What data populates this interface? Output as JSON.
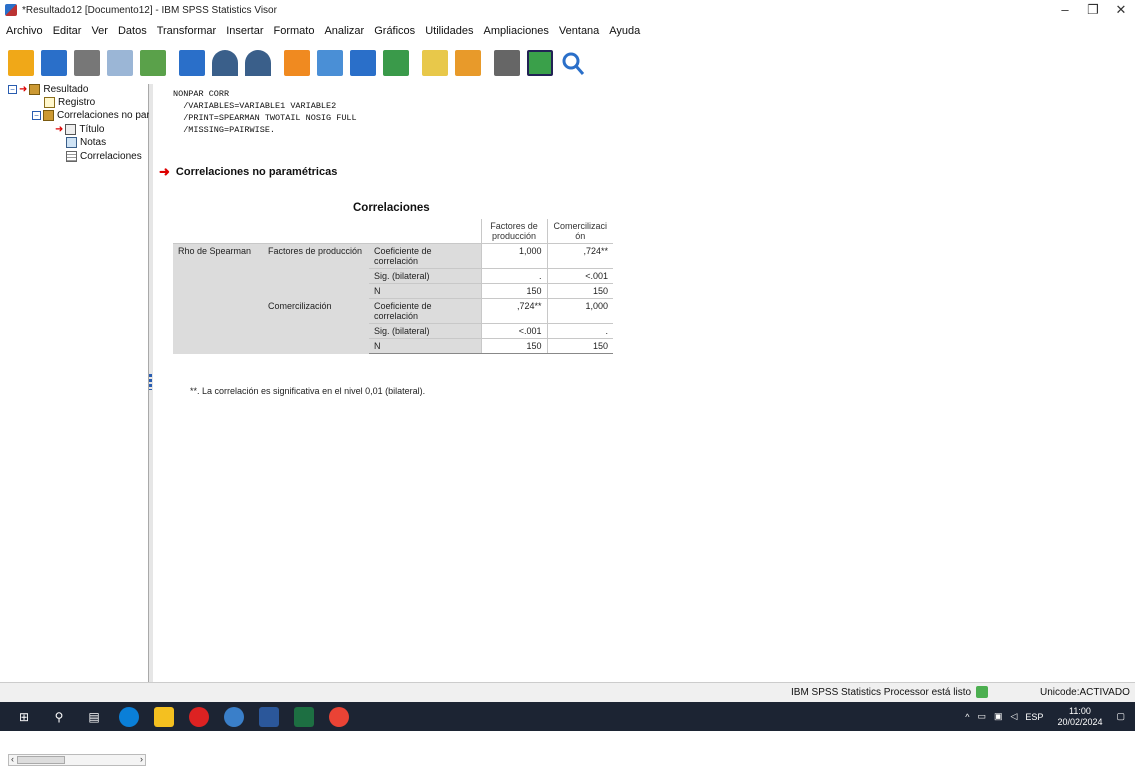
{
  "window": {
    "title": "*Resultado12 [Documento12] - IBM SPSS Statistics Visor"
  },
  "controls": {
    "minimize": "–",
    "maximize": "❐",
    "close": "✕"
  },
  "menu": [
    "Archivo",
    "Editar",
    "Ver",
    "Datos",
    "Transformar",
    "Insertar",
    "Formato",
    "Analizar",
    "Gráficos",
    "Utilidades",
    "Ampliaciones",
    "Ventana",
    "Ayuda"
  ],
  "toolbar": {
    "icons": [
      "open-icon",
      "save-icon",
      "print-icon",
      "print-preview-icon",
      "export-icon",
      "recall-dialog-icon",
      "undo-icon",
      "redo-icon",
      "goto-data-icon",
      "goto-case-icon",
      "goto-variable-icon",
      "variables-icon",
      "insert-output-icon",
      "create-title-icon",
      "hide-icon",
      "show-all-icon",
      "search-icon"
    ]
  },
  "tree": {
    "items": [
      {
        "label": "Resultado"
      },
      {
        "label": "Registro"
      },
      {
        "label": "Correlaciones no para"
      },
      {
        "label": "Título"
      },
      {
        "label": "Notas"
      },
      {
        "label": "Correlaciones"
      }
    ]
  },
  "content": {
    "syntax": "NONPAR CORR\n  /VARIABLES=VARIABLE1 VARIABLE2\n  /PRINT=SPEARMAN TWOTAIL NOSIG FULL\n  /MISSING=PAIRWISE.",
    "heading": "Correlaciones no paramétricas",
    "table": {
      "title": "Correlaciones",
      "col_headers": [
        "Factores de producción",
        "Comercilizaci ón"
      ],
      "row_group": "Rho de Spearman",
      "rows": [
        {
          "var": "Factores de producción",
          "stat": "Coeficiente de correlación",
          "v1": "1,000",
          "v2": ",724**"
        },
        {
          "var": "",
          "stat": "Sig. (bilateral)",
          "v1": ".",
          "v2": "<.001"
        },
        {
          "var": "",
          "stat": "N",
          "v1": "150",
          "v2": "150"
        },
        {
          "var": "Comercilización",
          "stat": "Coeficiente de correlación",
          "v1": ",724**",
          "v2": "1,000"
        },
        {
          "var": "",
          "stat": "Sig. (bilateral)",
          "v1": "<.001",
          "v2": "."
        },
        {
          "var": "",
          "stat": "N",
          "v1": "150",
          "v2": "150"
        }
      ],
      "footnote": "**. La correlación es significativa en el nivel 0,01 (bilateral)."
    }
  },
  "status": {
    "processor": "IBM SPSS Statistics Processor está listo",
    "unicode": "Unicode:ACTIVADO"
  },
  "taskbar": {
    "time": "11:00",
    "date": "20/02/2024",
    "lang": "ESP"
  }
}
